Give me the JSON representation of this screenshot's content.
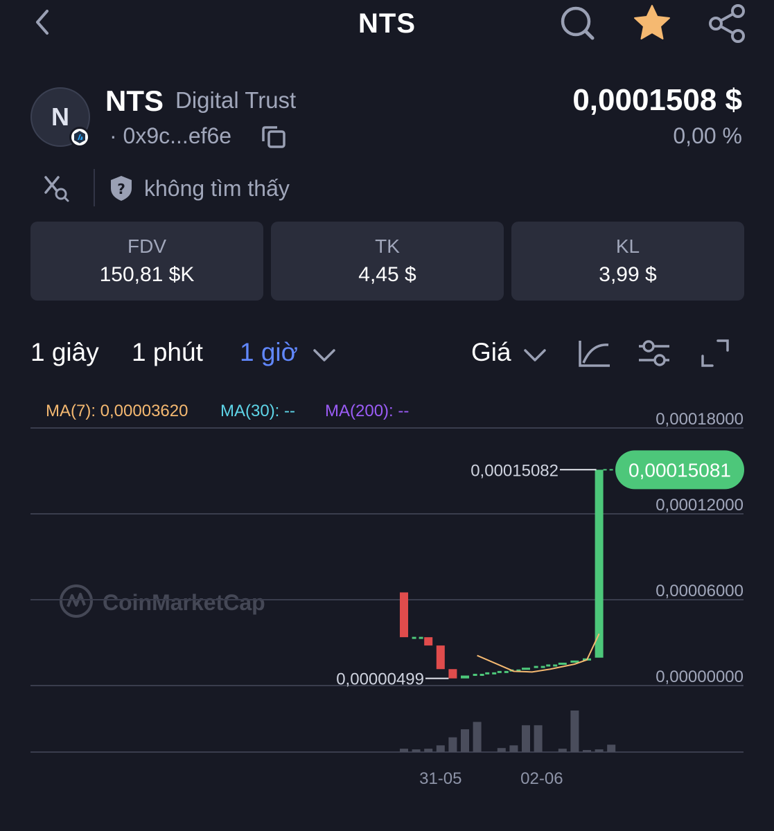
{
  "header": {
    "title": "NTS",
    "icons": [
      "back-chevron-icon",
      "search-icon",
      "star-icon",
      "share-icon"
    ],
    "star_color": "#f5b971"
  },
  "token": {
    "avatar_letter": "N",
    "symbol": "NTS",
    "name": "Digital Trust",
    "address": "· 0x9c...ef6e",
    "price": "0,0001508 $",
    "change": "0,00 %",
    "chain_badge_icon": "arbitrum-icon"
  },
  "audit": {
    "text": "không tìm thấy",
    "icons": [
      "x-search-icon",
      "shield-question-icon"
    ]
  },
  "stats": [
    {
      "label": "FDV",
      "value": "150,81 $K"
    },
    {
      "label": "TK",
      "value": "4,45 $"
    },
    {
      "label": "KL",
      "value": "3,99 $"
    }
  ],
  "timeframes": {
    "items": [
      "1 giây",
      "1 phút",
      "1 giờ"
    ],
    "active": "1 giờ",
    "price_mode": "Giá",
    "icons": [
      "line-chart-icon",
      "settings-sliders-icon",
      "fullscreen-icon"
    ]
  },
  "ma": {
    "ma7": "MA(7): 0,00003620",
    "ma30": "MA(30): --",
    "ma200": "MA(200): --",
    "colors": {
      "ma7": "#f5b971",
      "ma30": "#5ed5e8",
      "ma200": "#9b5cf6"
    }
  },
  "watermark": "CoinMarketCap",
  "chart_data": {
    "type": "candlestick",
    "y_ticks": [
      "0,00018000",
      "0,00012000",
      "0,00006000",
      "0,00000000"
    ],
    "y_tick_values": [
      0.00018,
      0.00012,
      6e-05,
      0
    ],
    "ylim": [
      0,
      0.00018
    ],
    "x_labels": [
      "31-05",
      "02-06"
    ],
    "high_label": "0,00015082",
    "high_value": 0.00015082,
    "low_label": "0,00000499",
    "low_value": 4.99e-06,
    "current_label": "0,00015081",
    "current_value": 0.00015081,
    "colors": {
      "up": "#4dc77a",
      "down": "#e04c4c",
      "ma7": "#f5b971",
      "grid": "#3a3d4d",
      "volume": "#4a4d5c"
    },
    "candles": [
      {
        "open": 6.51e-05,
        "close": 3.38e-05,
        "high": 6.51e-05,
        "low": 3.38e-05
      },
      {
        "open": 3.38e-05,
        "close": 3.38e-05,
        "high": 3.38e-05,
        "low": 3.38e-05
      },
      {
        "open": 3.38e-05,
        "close": 2.8e-05,
        "high": 3.38e-05,
        "low": 2.8e-05
      },
      {
        "open": 2.8e-05,
        "close": 1.15e-05,
        "high": 2.8e-05,
        "low": 1.15e-05
      },
      {
        "open": 1.15e-05,
        "close": 5e-06,
        "high": 1.15e-05,
        "low": 5e-06
      },
      {
        "open": 5e-06,
        "close": 7e-06,
        "high": 7e-06,
        "low": 5e-06
      },
      {
        "open": 7e-06,
        "close": 8e-06,
        "high": 8e-06,
        "low": 7e-06
      },
      {
        "open": 8e-06,
        "close": 9e-06,
        "high": 9e-06,
        "low": 8e-06
      },
      {
        "open": 9e-06,
        "close": 1e-05,
        "high": 1e-05,
        "low": 9e-06
      },
      {
        "open": 1e-05,
        "close": 1.1e-05,
        "high": 1.1e-05,
        "low": 1e-05
      },
      {
        "open": 1.1e-05,
        "close": 1.25e-05,
        "high": 1.25e-05,
        "low": 1.1e-05
      },
      {
        "open": 1.25e-05,
        "close": 1.35e-05,
        "high": 1.35e-05,
        "low": 1.25e-05
      },
      {
        "open": 1.35e-05,
        "close": 1.45e-05,
        "high": 1.45e-05,
        "low": 1.35e-05
      },
      {
        "open": 1.45e-05,
        "close": 1.6e-05,
        "high": 1.6e-05,
        "low": 1.45e-05
      },
      {
        "open": 1.6e-05,
        "close": 1.75e-05,
        "high": 1.75e-05,
        "low": 1.6e-05
      },
      {
        "open": 1.75e-05,
        "close": 1.9e-05,
        "high": 1.9e-05,
        "low": 1.75e-05
      },
      {
        "open": 1.95e-05,
        "close": 0.0001508,
        "high": 0.0001508,
        "low": 1.95e-05
      }
    ],
    "volume": [
      5,
      4,
      5,
      10,
      22,
      34,
      45,
      0,
      6,
      10,
      40,
      40,
      0,
      5,
      62,
      3,
      4,
      11
    ],
    "ma7_line": [
      {
        "i": 6,
        "v": 2.1e-05
      },
      {
        "i": 7.5,
        "v": 1.55e-05
      },
      {
        "i": 9,
        "v": 1e-05
      },
      {
        "i": 10.5,
        "v": 9.5e-06
      },
      {
        "i": 12,
        "v": 1.15e-05
      },
      {
        "i": 14,
        "v": 1.5e-05
      },
      {
        "i": 15,
        "v": 1.8e-05
      },
      {
        "i": 16,
        "v": 3.62e-05
      }
    ]
  }
}
